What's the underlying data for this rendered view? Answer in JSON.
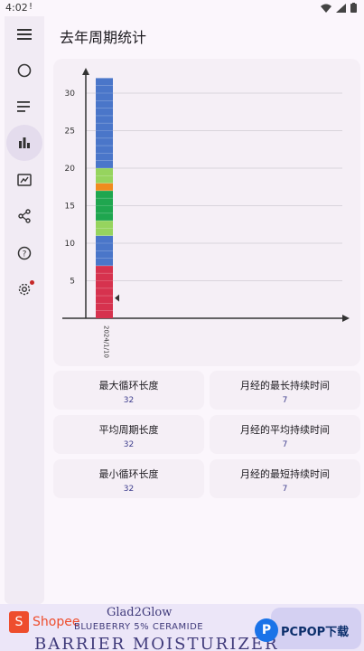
{
  "status_bar": {
    "time": "4:02",
    "notification_glyph": "!"
  },
  "page": {
    "title": "去年周期统计"
  },
  "rail": {
    "items": [
      {
        "name": "menu-icon"
      },
      {
        "name": "circle-icon"
      },
      {
        "name": "list-icon"
      },
      {
        "name": "bar-chart-icon",
        "active": true
      },
      {
        "name": "edit-chart-icon"
      },
      {
        "name": "share-icon"
      },
      {
        "name": "help-icon"
      },
      {
        "name": "settings-icon",
        "badge": true
      }
    ]
  },
  "chart_data": {
    "type": "bar",
    "categories": [
      "2024/1/10"
    ],
    "ylim": [
      0,
      34
    ],
    "yticks": [
      5,
      10,
      15,
      20,
      25,
      30
    ],
    "total": 32,
    "segments": [
      {
        "from": 0,
        "to": 7,
        "color": "#d6324e"
      },
      {
        "from": 7,
        "to": 11,
        "color": "#4a76c9"
      },
      {
        "from": 11,
        "to": 13,
        "color": "#96d45e"
      },
      {
        "from": 13,
        "to": 17,
        "color": "#1fa64f"
      },
      {
        "from": 17,
        "to": 18,
        "color": "#f08c1e"
      },
      {
        "from": 18,
        "to": 20,
        "color": "#96d45e"
      },
      {
        "from": 20,
        "to": 32,
        "color": "#4a76c9"
      }
    ],
    "marker_value": 2.7
  },
  "stats": {
    "max_cycle": {
      "label": "最大循环长度",
      "value": "32"
    },
    "max_period": {
      "label": "月经的最长持续时间",
      "value": "7"
    },
    "avg_cycle": {
      "label": "平均周期长度",
      "value": "32"
    },
    "avg_period": {
      "label": "月经的平均持续时间",
      "value": "7"
    },
    "min_cycle": {
      "label": "最小循环长度",
      "value": "32"
    },
    "min_period": {
      "label": "月经的最短持续时间",
      "value": "7"
    }
  },
  "ad": {
    "shopee": "Shopee",
    "brand": "Glad2Glow",
    "line1": "BLUEBERRY 5% CERAMIDE",
    "line2": "BARRIER MOISTURIZER",
    "watermark": "PCPOP下载"
  },
  "colors": {
    "accent": "#3f3f8e",
    "card": "#f5eff6",
    "rail": "#f1ebf4"
  }
}
